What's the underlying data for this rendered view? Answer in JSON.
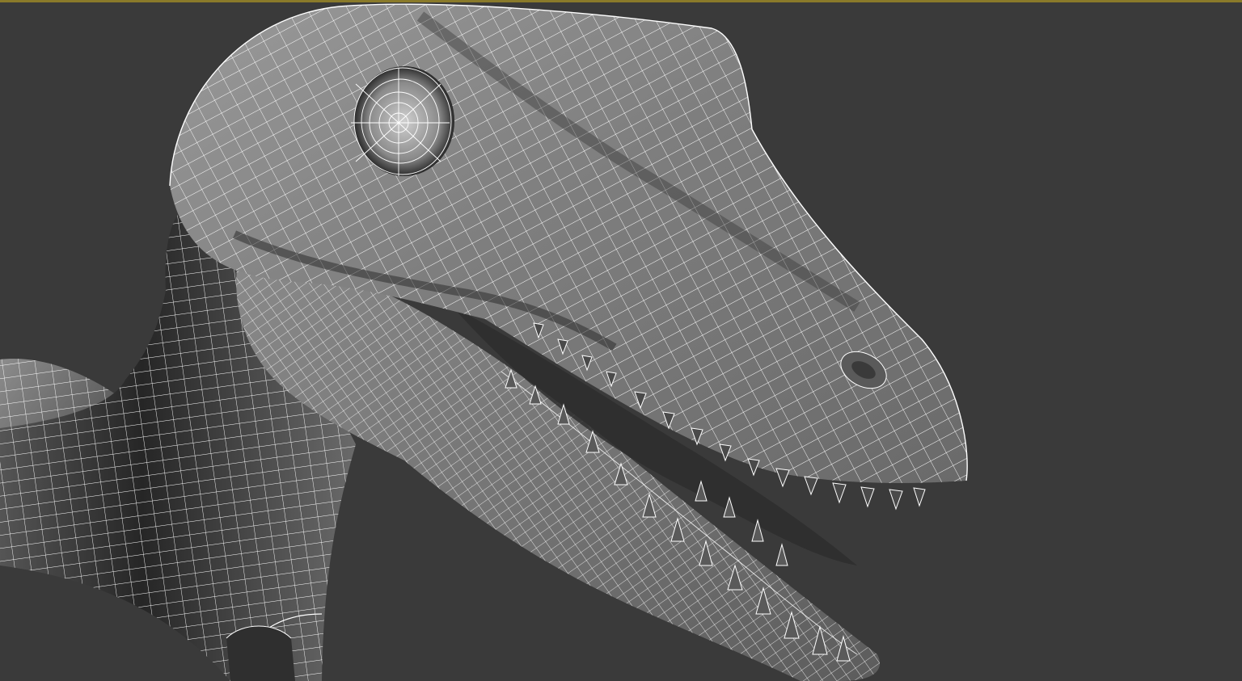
{
  "viewport": {
    "background_color": "#3a3a3a",
    "active_border_color": "#8a7a2a",
    "display_mode": "shaded-with-wireframe",
    "wire_color": "#ffffff",
    "subject": "dinosaur-head-model"
  }
}
